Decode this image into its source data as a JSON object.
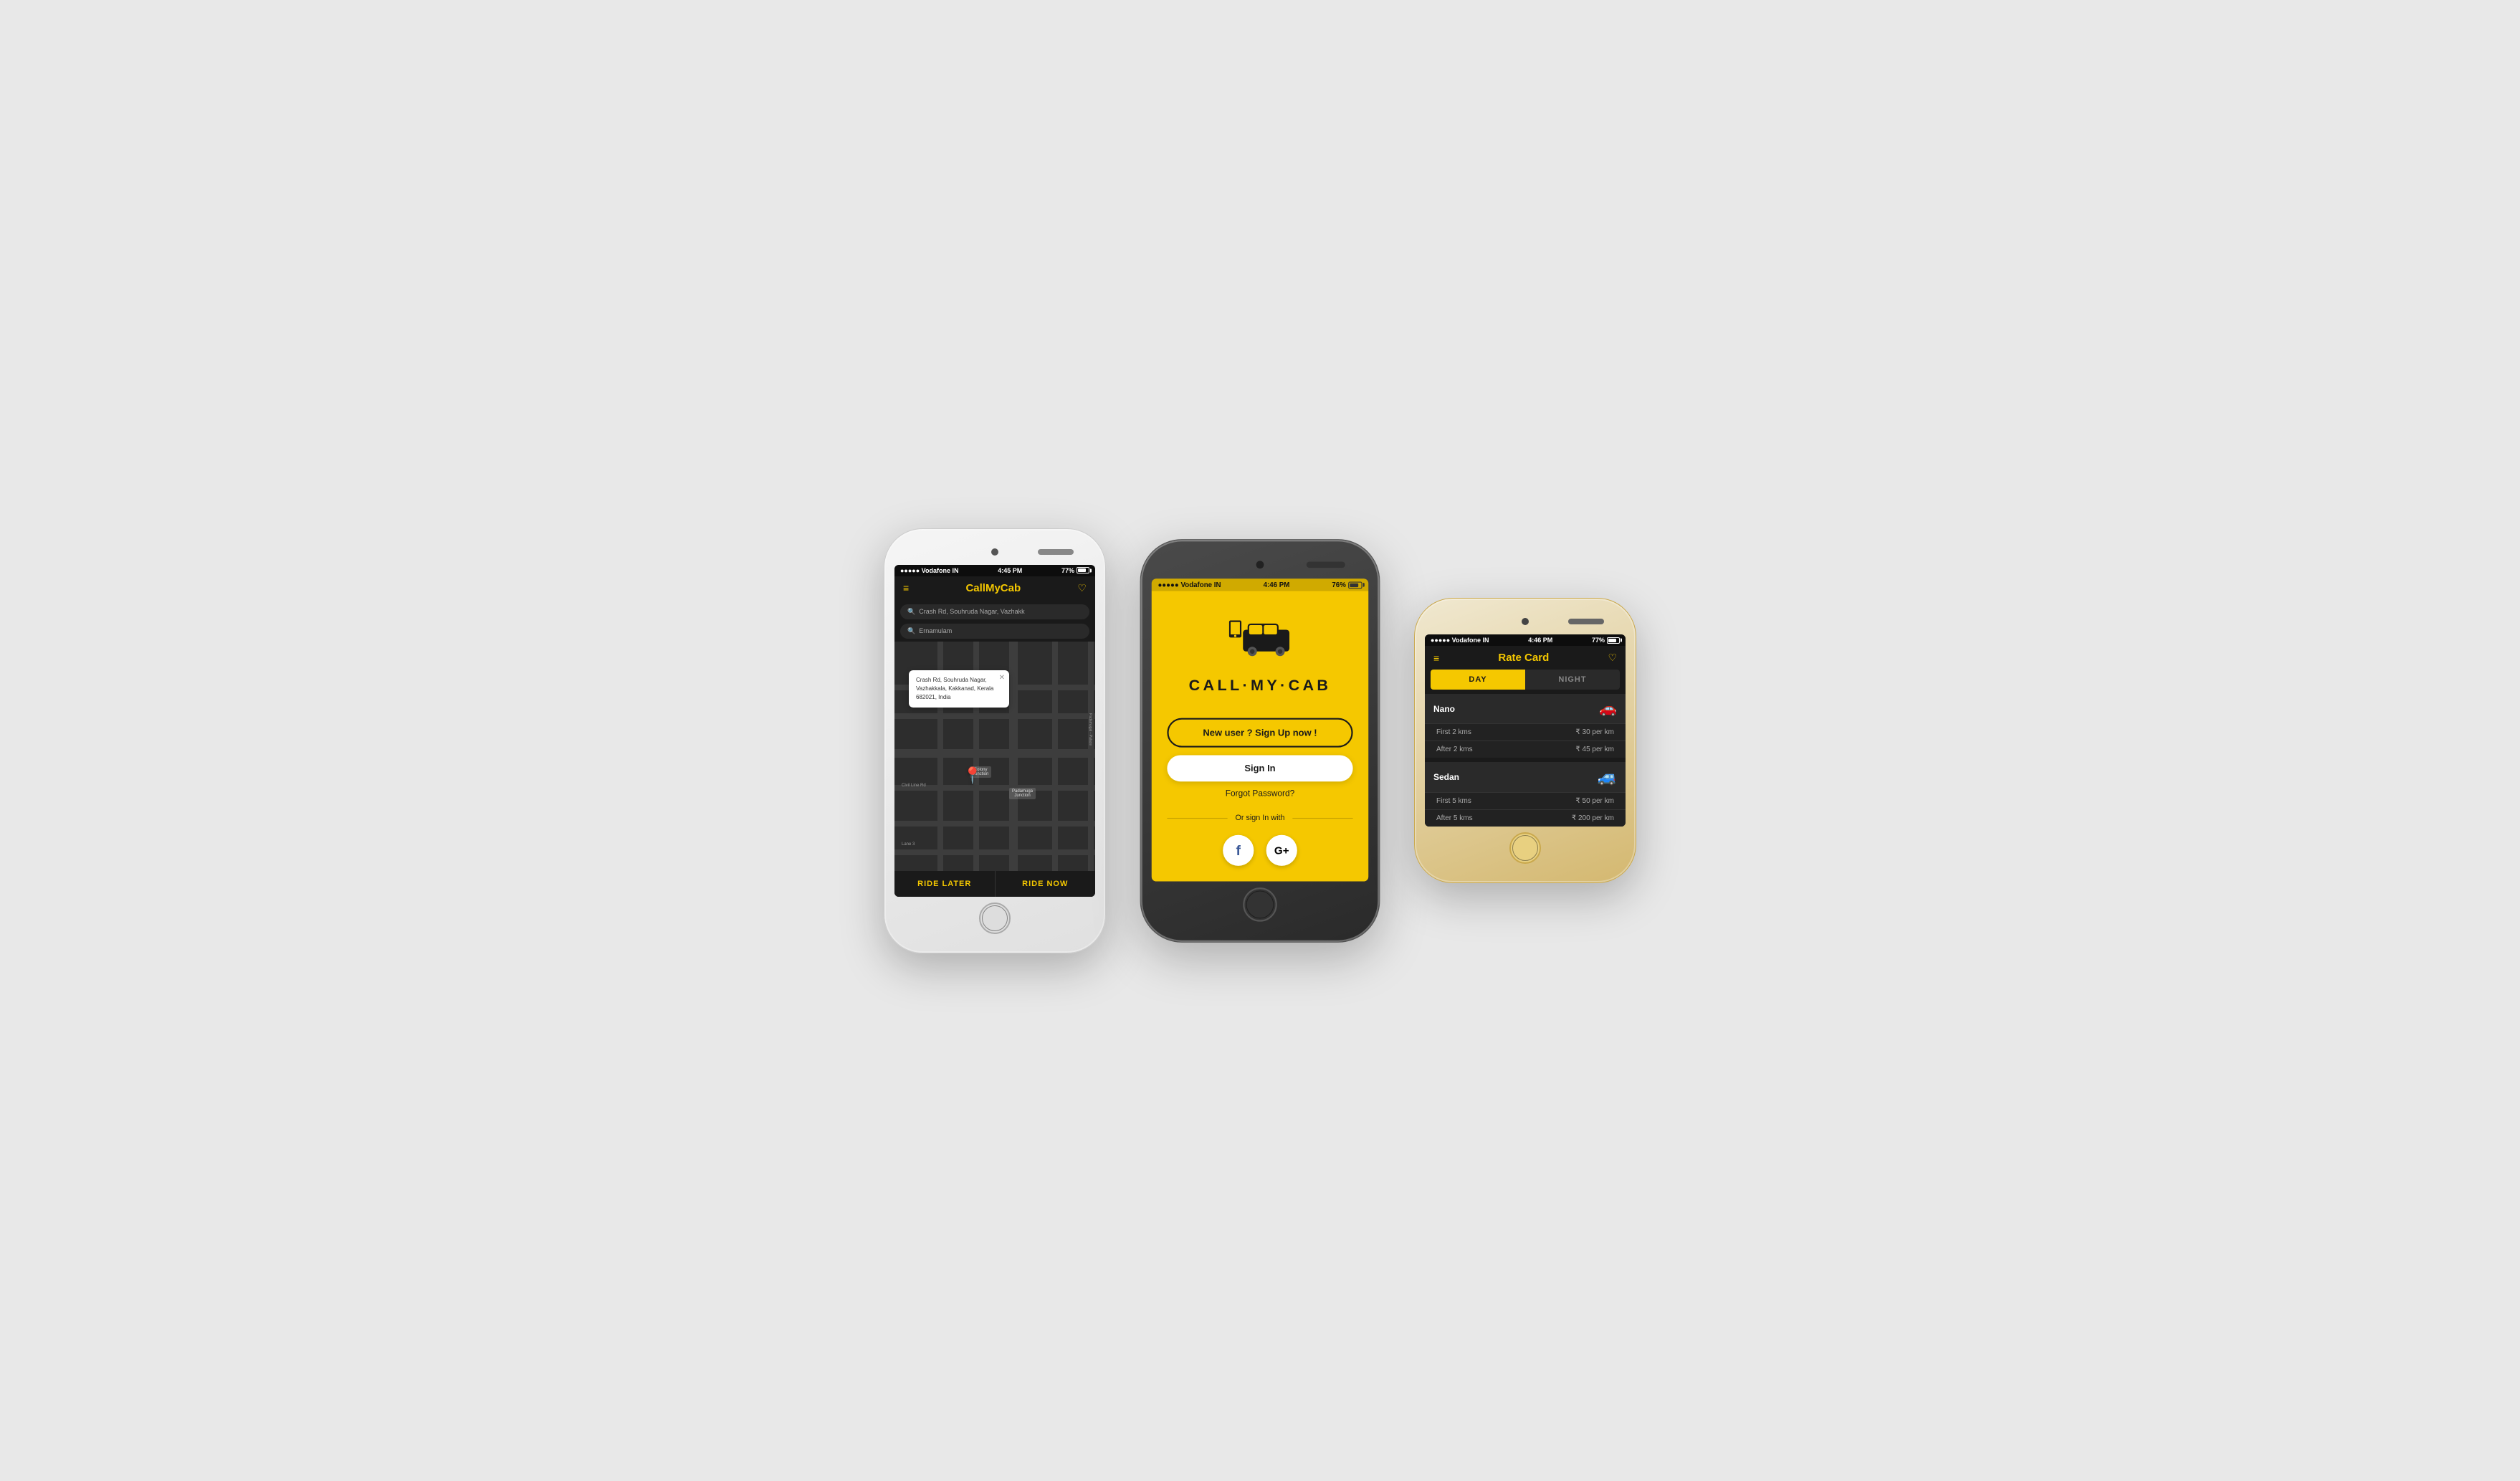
{
  "page": {
    "bg_color": "#e8e8e8"
  },
  "phone1": {
    "status": {
      "carrier": "●●●●● Vodafone IN",
      "wifi": "WiFi",
      "time": "4:45 PM",
      "battery": "77%"
    },
    "header": {
      "title": "CallMyCab",
      "hamburger": "≡",
      "heart": "♡"
    },
    "search1": {
      "icon": "🔍",
      "value": "Crash Rd, Souhruda Nagar, Vazhakk"
    },
    "search2": {
      "icon": "🔍",
      "value": "Ernamulam"
    },
    "map_popup": {
      "address": "Crash Rd, Souhruda Nagar,\nVazhakkala, Kakkanad, Kerala\n682021, India",
      "close": "✕"
    },
    "bottom": {
      "left": "RIDE LATER",
      "right": "RIDE NOW"
    }
  },
  "phone2": {
    "status": {
      "carrier": "●●●●● Vodafone IN",
      "wifi": "WiFi",
      "time": "4:46 PM",
      "battery": "76%"
    },
    "logo": {
      "text": "CALL·MY·CAB"
    },
    "buttons": {
      "signup": "New user ? Sign Up now !",
      "signin": "Sign In",
      "forgot": "Forgot Password?"
    },
    "social": {
      "divider_text": "Or sign In with",
      "facebook_label": "f",
      "google_label": "G+"
    }
  },
  "phone3": {
    "status": {
      "carrier": "●●●●● Vodafone IN",
      "wifi": "WiFi",
      "time": "4:46 PM",
      "battery": "77%"
    },
    "header": {
      "title": "Rate Card",
      "hamburger": "≡",
      "heart": "♡"
    },
    "tabs": {
      "day": "DAY",
      "night": "NIGHT"
    },
    "nano": {
      "name": "Nano",
      "row1_label": "First 2 kms",
      "row1_value": "₹ 30 per km",
      "row2_label": "After 2 kms",
      "row2_value": "₹ 45 per km"
    },
    "sedan": {
      "name": "Sedan",
      "row1_label": "First 5 kms",
      "row1_value": "₹ 50 per km",
      "row2_label": "After 5 kms",
      "row2_value": "₹ 200 per km"
    }
  }
}
